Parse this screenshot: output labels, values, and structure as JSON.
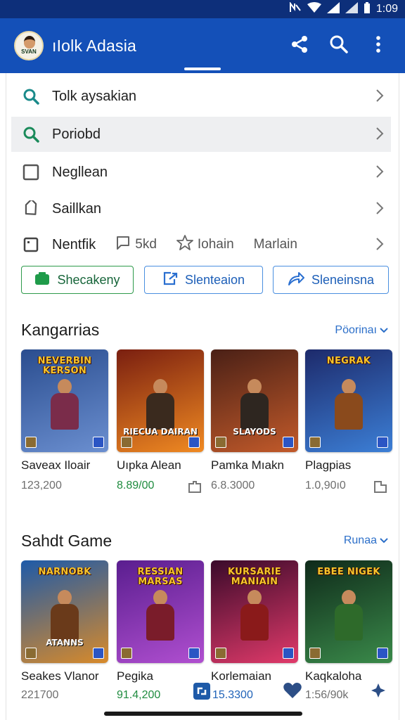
{
  "status_bar": {
    "time": "1:09"
  },
  "app_bar": {
    "title": "ıIolk Adasia",
    "avatar_label": "SVAN"
  },
  "menu": [
    {
      "label": "Tolk aysakian",
      "icon": "search-icon"
    },
    {
      "label": "Poriobd",
      "icon": "search-icon"
    },
    {
      "label": "Negllean",
      "icon": "checkbox-icon"
    },
    {
      "label": "Saillkan",
      "icon": "tag-icon"
    }
  ],
  "meta_row": {
    "label": "Nentfik",
    "items": [
      {
        "label": "5kd",
        "icon": "chat-icon"
      },
      {
        "label": "Iohain",
        "icon": "star-icon"
      },
      {
        "label": "Marlain",
        "icon": ""
      }
    ]
  },
  "chips": [
    {
      "label": "Shecakeny",
      "icon": "camera-icon"
    },
    {
      "label": "Slenteaion",
      "icon": "export-icon"
    },
    {
      "label": "Sleneinsna",
      "icon": "share-arrow-icon"
    }
  ],
  "sections": [
    {
      "title": "Kangarrias",
      "link": "Pöorinaı",
      "games": [
        {
          "name": "Saveax Iloair",
          "price": "123,200",
          "price_color": "grey",
          "banner": "NEVERBIN KERSON",
          "bottom_text": "",
          "bg": [
            "#2a4d8f",
            "#6b8fd0"
          ],
          "hero": "#7a2c4a"
        },
        {
          "name": "Uıpka Alean",
          "price": "8.89/00",
          "price_color": "green",
          "banner": "",
          "bottom_text": "RIECUA DAIRAN",
          "bg": [
            "#7a1f10",
            "#f08a22"
          ],
          "hero": "#3a2a1e"
        },
        {
          "name": "Pamka Mıakn",
          "price": "6.8.3000",
          "price_color": "grey",
          "banner": "",
          "bottom_text": "SLAYODS",
          "bg": [
            "#4a2016",
            "#c25a2a"
          ],
          "hero": "#2e2620"
        },
        {
          "name": "Plagpias",
          "price": "1.0,90ı0",
          "price_color": "grey",
          "banner": "NEGRAK",
          "bottom_text": "",
          "bg": [
            "#1d2a6b",
            "#3c7fd6"
          ],
          "hero": "#8a4a1c"
        }
      ]
    },
    {
      "title": "Sahdt Game",
      "link": "Runaa",
      "games": [
        {
          "name": "Seakes Vlanor",
          "price": "221700",
          "price_color": "grey",
          "banner": "NARNOBK",
          "bottom_text": "ATANNS",
          "bg": [
            "#1e5aa8",
            "#d88a2a"
          ],
          "hero": "#6a3a1a"
        },
        {
          "name": "Pegika",
          "price": "91.4,200",
          "price_color": "green",
          "banner": "RESSIAN MARSAS",
          "bottom_text": "",
          "bg": [
            "#5a1e8f",
            "#b04fd0"
          ],
          "hero": "#7a1c2a"
        },
        {
          "name": "Korlemaian",
          "price": "15.3300",
          "price_color": "blue",
          "banner": "KURSARIE MANIAIN",
          "bottom_text": "",
          "bg": [
            "#3a0a2a",
            "#e03a6a"
          ],
          "hero": "#8a1a1a"
        },
        {
          "name": "Kaqkaloha",
          "price": "1:56/90k",
          "price_color": "grey",
          "banner": "EBEE NIGEK",
          "bottom_text": "",
          "bg": [
            "#0f2a1a",
            "#3a8a4a"
          ],
          "hero": "#2e6a2a"
        }
      ]
    }
  ]
}
